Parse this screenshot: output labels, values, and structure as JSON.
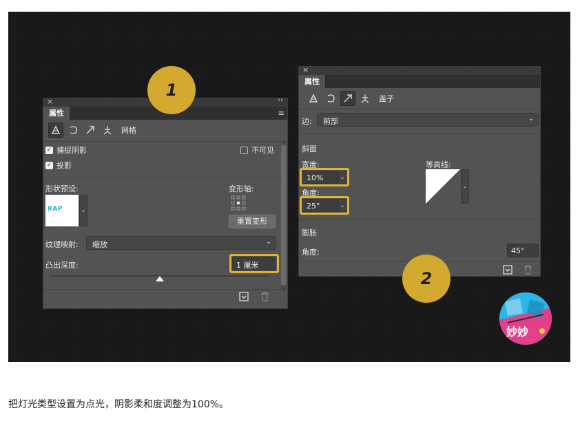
{
  "panel1": {
    "tab": "属性",
    "icon_row_label": "网格",
    "capture_shadow": "捕捉阴影",
    "invisible": "不可见",
    "cast_shadow": "投影",
    "shape_preset_label": "形状预设:",
    "shape_thumb_text": "RAP",
    "deform_axis_label": "变形轴:",
    "reset_deform": "重置变形",
    "texture_mapping_label": "纹理映射:",
    "texture_mapping_value": "缩放",
    "extrusion_depth_label": "凸出深度:",
    "extrusion_depth_value": "1 厘米",
    "slider_value": 0.5
  },
  "panel2": {
    "tab": "属性",
    "icon_row_label": "盖子",
    "side_label": "边:",
    "side_value": "前部",
    "bevel_heading": "斜面",
    "width_label": "宽度:",
    "width_value": "10%",
    "angle_label": "角度:",
    "angle_value": "25°",
    "contour_label": "等高线:",
    "inflate_heading": "膨胀",
    "inflate_angle_label": "角度:",
    "inflate_angle_value": "45°"
  },
  "badges": {
    "one": "1",
    "two": "2"
  },
  "logo_text": "妙妙",
  "caption": "把灯光类型设置为点光，阴影柔和度调整为100%。",
  "colors": {
    "highlight": "#e0b431",
    "badge": "#d4a92f",
    "panel": "#535353",
    "stage": "#161616"
  },
  "icons": [
    "close-icon",
    "collapse-icon",
    "panel-menu-icon",
    "scene-icon",
    "mesh-icon",
    "deform-icon",
    "cap-icon",
    "coordinates-icon",
    "render-icon",
    "trash-icon"
  ]
}
